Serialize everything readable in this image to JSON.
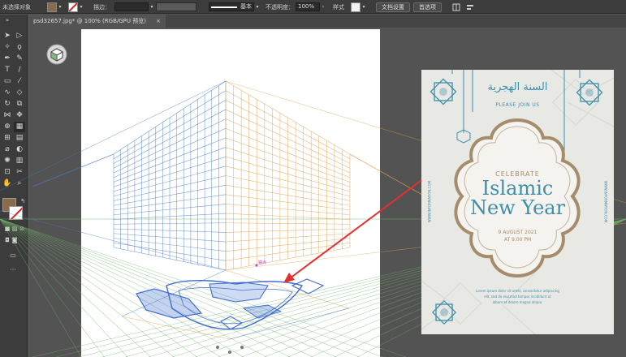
{
  "control_bar": {
    "no_selection": "未选择对象",
    "stroke_label": "描边：",
    "stroke_style": "基本",
    "opacity_label": "不透明度：",
    "opacity_value": "100%",
    "style_label": "样式",
    "doc_setup": "文档设置",
    "preferences": "首选项"
  },
  "tab": {
    "title": "psd32657.jpg* @ 100% (RGB/GPU 预览)",
    "close": "×"
  },
  "canvas": {
    "point_label": "锚点"
  },
  "poster": {
    "arabic": "السنة الهجرية",
    "please_join": "PLEASE JOIN US",
    "celebrate": "CELEBRATE",
    "islamic": "Islamic",
    "new_year": "New Year",
    "date": "9 AUGUST 2021",
    "time": "AT 9.00 PM",
    "body1": "Lorem ipsum dolor sit amet, consectetur adipiscing",
    "body2": "elit, sed do eiusmod tempor incididunt ut",
    "body3": "labore et dolore magna aliqua.",
    "side_left": "WWW.INFORMATION.COM",
    "side_right": "WWW.INFORMATION.COM"
  },
  "colors": {
    "fill_swatch": "#8b6b4e",
    "grid_left": "#4b7cc8",
    "grid_right": "#e0a04a",
    "grid_ground": "#6fb36a",
    "arrow": "#e53030",
    "poster_teal": "#3e8fa8",
    "poster_gold": "#a58c6b"
  }
}
